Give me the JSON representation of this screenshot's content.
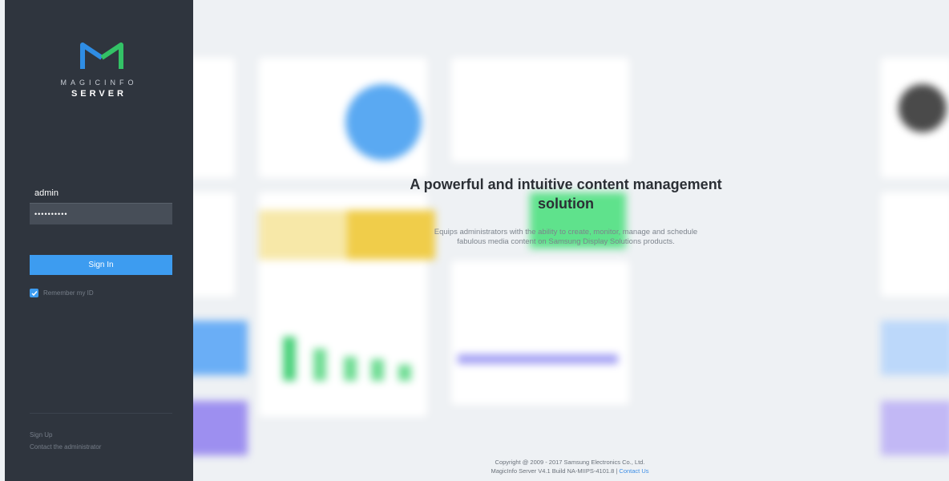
{
  "brand": {
    "line1": "MAGICINFO",
    "line2": "SERVER",
    "logo_icon": "magicinfo-m-logo-icon",
    "colors": {
      "logo_left": "#2f8de4",
      "logo_right": "#33c266",
      "accent": "#3d9cf0",
      "panel": "#2f353e"
    }
  },
  "login": {
    "username_value": "admin",
    "password_value": "••••••••••",
    "signin_label": "Sign In",
    "remember_label": "Remember my ID",
    "remember_checked": true
  },
  "links": {
    "signup": "Sign Up",
    "contact_admin": "Contact the administrator"
  },
  "hero": {
    "title": "A powerful and intuitive content management solution",
    "subtitle": "Equips administrators with the ability to create, monitor, manage and schedule fabulous media content on Samsung Display Solutions products."
  },
  "footer": {
    "copyright": "Copyright @ 2009 - 2017 Samsung Electronics Co., Ltd.",
    "build": "MagicInfo Server V4.1 Build NA-MIIPS-4101.8 |",
    "contact_us": "Contact Us"
  }
}
